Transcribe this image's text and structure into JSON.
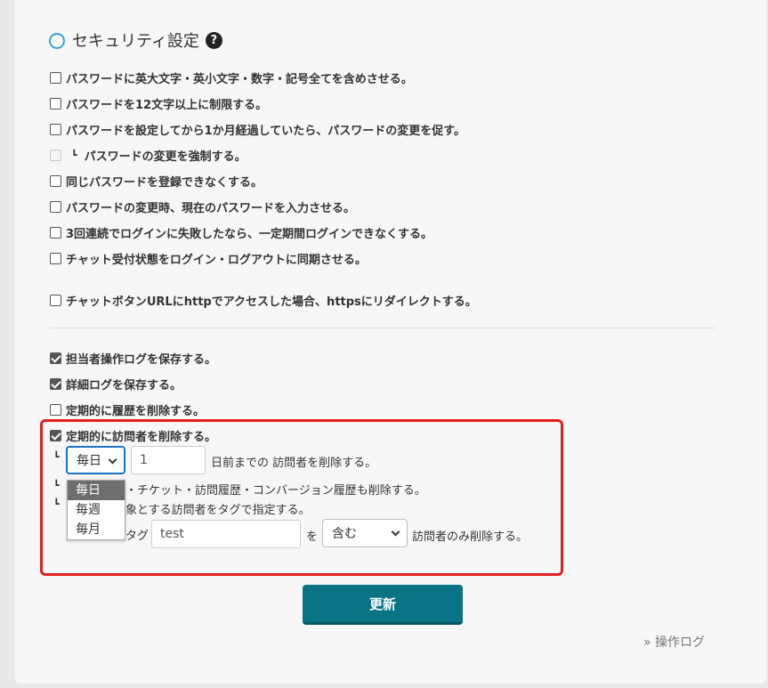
{
  "section": {
    "title": "セキュリティ設定",
    "help_icon": "?"
  },
  "options": [
    {
      "label": "パスワードに英大文字・英小文字・数字・記号全てを含めさせる。",
      "checked": false
    },
    {
      "label": "パスワードを12文字以上に制限する。",
      "checked": false
    },
    {
      "label": "パスワードを設定してから1か月経過していたら、パスワードの変更を促す。",
      "checked": false
    },
    {
      "label": "パスワードの変更を強制する。",
      "checked": false,
      "disabled": true
    },
    {
      "label": "同じパスワードを登録できなくする。",
      "checked": false
    },
    {
      "label": "パスワードの変更時、現在のパスワードを入力させる。",
      "checked": false
    },
    {
      "label": "3回連続でログインに失敗したなら、一定期間ログインできなくする。",
      "checked": false
    },
    {
      "label": "チャット受付状態をログイン・ログアウトに同期させる。",
      "checked": false
    },
    {
      "label": "チャットボタンURLにhttpでアクセスした場合、httpsにリダイレクトする。",
      "checked": false
    }
  ],
  "log_options": [
    {
      "label": "担当者操作ログを保存する。",
      "checked": true
    },
    {
      "label": "詳細ログを保存する。",
      "checked": true
    },
    {
      "label": "定期的に履歴を削除する。",
      "checked": false
    },
    {
      "label": "定期的に訪問者を削除する。",
      "checked": true
    }
  ],
  "visitor_delete": {
    "frequency_value": "毎日",
    "frequency_options": [
      "毎日",
      "毎週",
      "毎月"
    ],
    "days_value": "1",
    "days_suffix": "日前までの 訪問者を削除する。",
    "also_delete_partial": "・チケット・訪問履歴・コンバージョン履歴も削除する。",
    "target_partial": "象とする訪問者をタグで指定する。",
    "tag_label_partial": "タグ",
    "tag_value": "test",
    "wo": "を",
    "match_value": "含む",
    "match_suffix": "訪問者のみ削除する。"
  },
  "buttons": {
    "update": "更新"
  },
  "links": {
    "operation_log": "» 操作ログ"
  },
  "colors": {
    "accent": "#087486",
    "highlight_border": "#e02020",
    "ring": "#33a6d1"
  }
}
